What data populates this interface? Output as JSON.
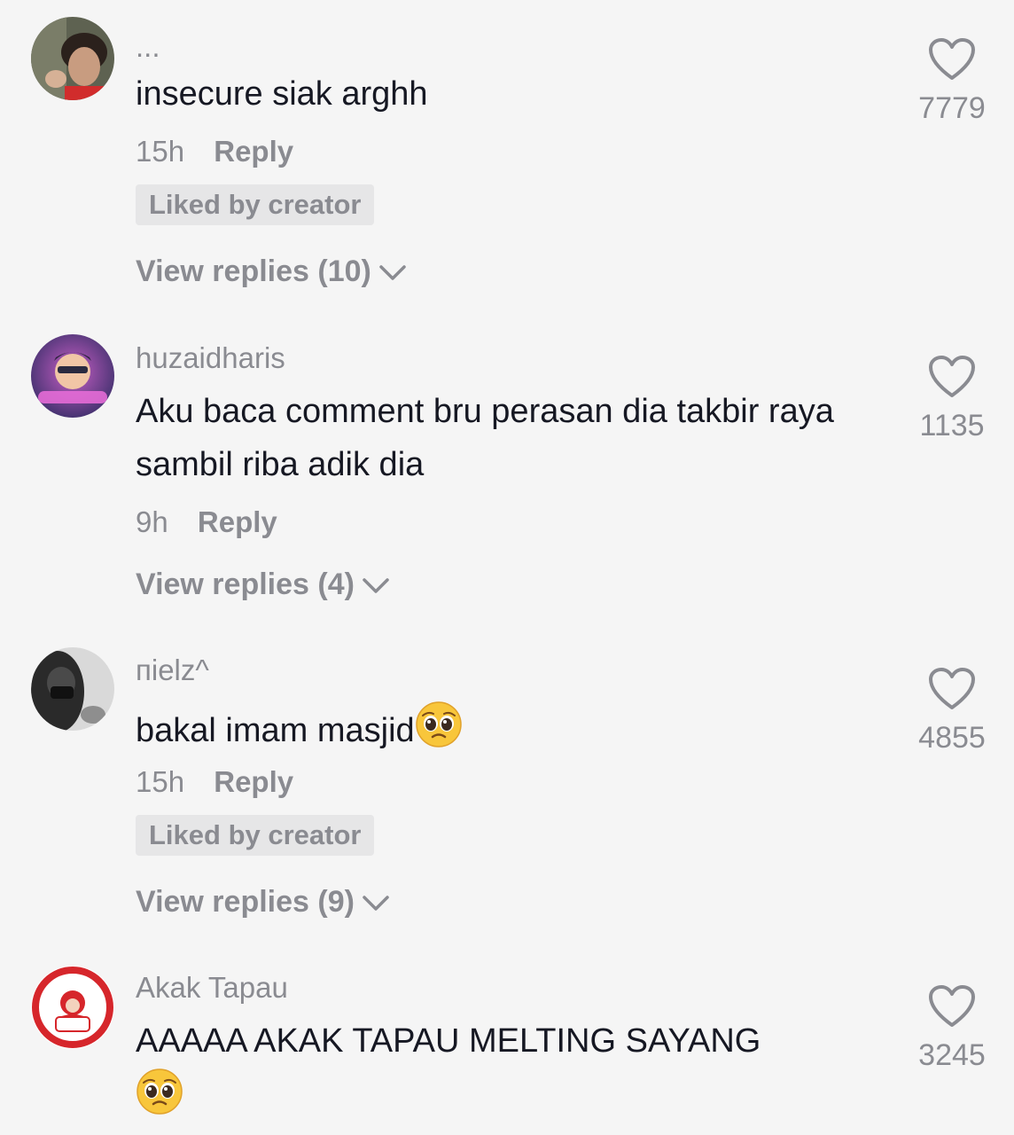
{
  "comments": [
    {
      "username": "...",
      "text": "insecure siak arghh",
      "time": "15h",
      "reply_label": "Reply",
      "badge": "Liked by creator",
      "view_replies": "View replies (10)",
      "likes": "7779",
      "avatar_colors": [
        "#6b6b55",
        "#3a2f2a",
        "#d9b59a"
      ]
    },
    {
      "username": "huzaidharis",
      "text": "Aku baca comment bru perasan dia takbir raya sambil riba adik dia",
      "time": "9h",
      "reply_label": "Reply",
      "badge": "",
      "view_replies": "View replies (4)",
      "likes": "1135",
      "avatar_colors": [
        "#4a3b78",
        "#c45bc2",
        "#e8a0d8"
      ]
    },
    {
      "username": "пielz^",
      "text": "bakal imam masjid",
      "time": "15h",
      "reply_label": "Reply",
      "badge": "Liked by creator",
      "view_replies": "View replies (9)",
      "likes": "4855",
      "avatar_colors": [
        "#d8d8d8",
        "#2b2b2b",
        "#9a9a9a"
      ]
    },
    {
      "username": "Akak Tapau",
      "text": "AAAAA AKAK TAPAU MELTING SAYANG",
      "time": "",
      "reply_label": "",
      "badge": "",
      "view_replies": "",
      "likes": "3245",
      "avatar_colors": [
        "#ffffff",
        "#d6262b",
        "#f2c9c9"
      ]
    }
  ],
  "icons": {
    "like": "heart-outline-icon",
    "expand": "chevron-down-icon",
    "emoji": "pleading-face-emoji"
  },
  "colors": {
    "background": "#f5f5f5",
    "primary_text": "#161823",
    "secondary_text": "#8a8b91",
    "badge_bg": "#e6e6e7"
  }
}
